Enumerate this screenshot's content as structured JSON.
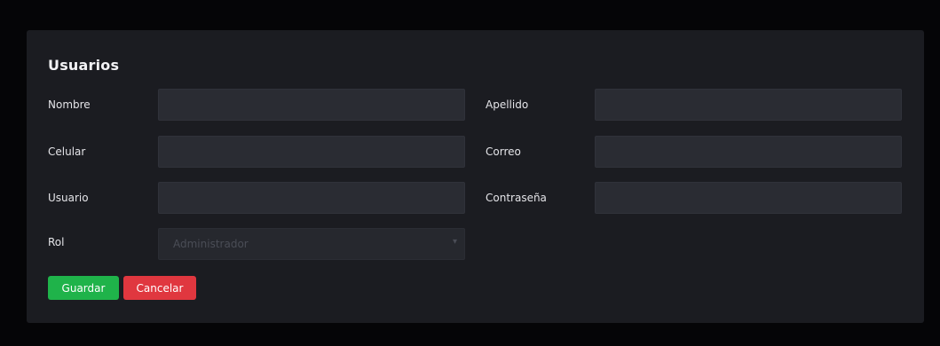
{
  "form": {
    "title": "Usuarios",
    "fields": {
      "nombre": {
        "label": "Nombre",
        "value": ""
      },
      "apellido": {
        "label": "Apellido",
        "value": ""
      },
      "celular": {
        "label": "Celular",
        "value": ""
      },
      "correo": {
        "label": "Correo",
        "value": ""
      },
      "usuario": {
        "label": "Usuario",
        "value": ""
      },
      "contrasena": {
        "label": "Contraseña",
        "value": ""
      },
      "rol": {
        "label": "Rol",
        "selected": "Administrador"
      }
    },
    "buttons": {
      "save_label": "Guardar",
      "cancel_label": "Cancelar"
    }
  },
  "colors": {
    "background": "#050507",
    "card": "#1b1c21",
    "input": "#2a2c33",
    "save": "#1fb34a",
    "cancel": "#e0373f"
  }
}
